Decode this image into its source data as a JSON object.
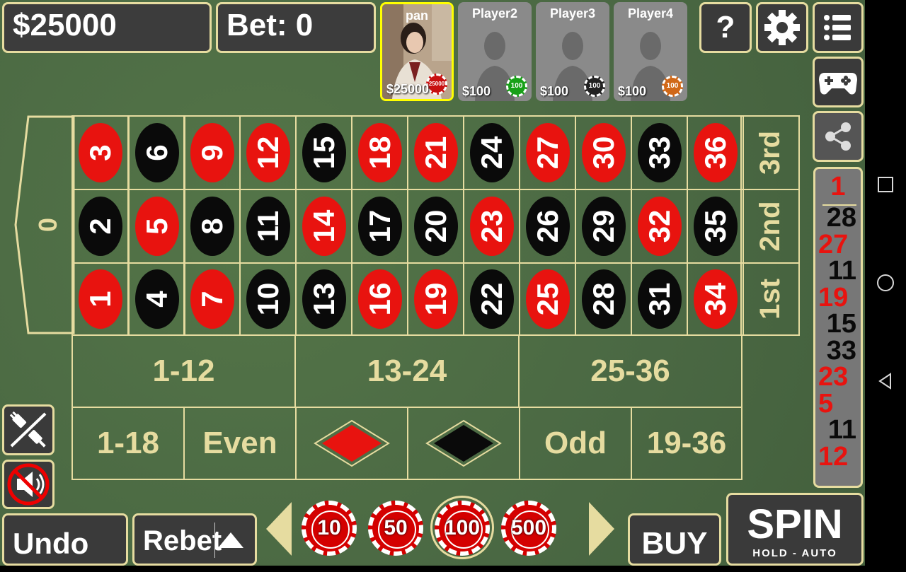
{
  "header": {
    "balance": "$25000",
    "bet": "Bet: 0"
  },
  "players": [
    {
      "name": "pan",
      "money": "$25000",
      "chip": "25000",
      "chip_color": "#c81010",
      "has_photo": true
    },
    {
      "name": "Player2",
      "money": "$100",
      "chip": "100",
      "chip_color": "#18a018",
      "has_photo": false
    },
    {
      "name": "Player3",
      "money": "$100",
      "chip": "100",
      "chip_color": "#222222",
      "has_photo": false
    },
    {
      "name": "Player4",
      "money": "$100",
      "chip": "100",
      "chip_color": "#d06818",
      "has_photo": false
    }
  ],
  "top_buttons": {
    "help": "?",
    "settings_icon": "gear-icon",
    "menu_icon": "list-icon"
  },
  "side_buttons": {
    "gamepad_icon": "gamepad-icon",
    "share_icon": "share-icon"
  },
  "board": {
    "zero": "0",
    "rows": [
      [
        {
          "n": "3",
          "c": "red"
        },
        {
          "n": "6",
          "c": "black"
        },
        {
          "n": "9",
          "c": "red"
        },
        {
          "n": "12",
          "c": "red"
        },
        {
          "n": "15",
          "c": "black"
        },
        {
          "n": "18",
          "c": "red"
        },
        {
          "n": "21",
          "c": "red"
        },
        {
          "n": "24",
          "c": "black"
        },
        {
          "n": "27",
          "c": "red"
        },
        {
          "n": "30",
          "c": "red"
        },
        {
          "n": "33",
          "c": "black"
        },
        {
          "n": "36",
          "c": "red"
        }
      ],
      [
        {
          "n": "2",
          "c": "black"
        },
        {
          "n": "5",
          "c": "red"
        },
        {
          "n": "8",
          "c": "black"
        },
        {
          "n": "11",
          "c": "black"
        },
        {
          "n": "14",
          "c": "red"
        },
        {
          "n": "17",
          "c": "black"
        },
        {
          "n": "20",
          "c": "black"
        },
        {
          "n": "23",
          "c": "red"
        },
        {
          "n": "26",
          "c": "black"
        },
        {
          "n": "29",
          "c": "black"
        },
        {
          "n": "32",
          "c": "red"
        },
        {
          "n": "35",
          "c": "black"
        }
      ],
      [
        {
          "n": "1",
          "c": "red"
        },
        {
          "n": "4",
          "c": "black"
        },
        {
          "n": "7",
          "c": "red"
        },
        {
          "n": "10",
          "c": "black"
        },
        {
          "n": "13",
          "c": "black"
        },
        {
          "n": "16",
          "c": "red"
        },
        {
          "n": "19",
          "c": "red"
        },
        {
          "n": "22",
          "c": "black"
        },
        {
          "n": "25",
          "c": "red"
        },
        {
          "n": "28",
          "c": "black"
        },
        {
          "n": "31",
          "c": "black"
        },
        {
          "n": "34",
          "c": "red"
        }
      ]
    ],
    "columns": [
      "3rd",
      "2nd",
      "1st"
    ],
    "dozens": [
      "1-12",
      "13-24",
      "25-36"
    ],
    "even_money": {
      "low": "1-18",
      "even": "Even",
      "red": "red-diamond",
      "black": "black-diamond",
      "odd": "Odd",
      "high": "19-36"
    }
  },
  "history": [
    {
      "n": "1",
      "c": "red"
    },
    {
      "n": "28",
      "c": "black"
    },
    {
      "n": "27",
      "c": "red"
    },
    {
      "n": "11",
      "c": "black"
    },
    {
      "n": "19",
      "c": "red"
    },
    {
      "n": "15",
      "c": "black"
    },
    {
      "n": "33",
      "c": "black"
    },
    {
      "n": "23",
      "c": "red"
    },
    {
      "n": "5",
      "c": "red"
    },
    {
      "n": "11",
      "c": "black"
    },
    {
      "n": "12",
      "c": "red"
    }
  ],
  "bottom": {
    "undo": "Undo",
    "rebet": "Rebet",
    "chips": [
      "10",
      "50",
      "100",
      "500"
    ],
    "selected_chip": "100",
    "buy": "BUY",
    "spin": "SPIN",
    "spin_sub": "HOLD - AUTO"
  },
  "colors": {
    "felt": "#4b6a44",
    "trim": "#e6dca0",
    "red": "#e8130f",
    "black": "#0a0a0a"
  }
}
